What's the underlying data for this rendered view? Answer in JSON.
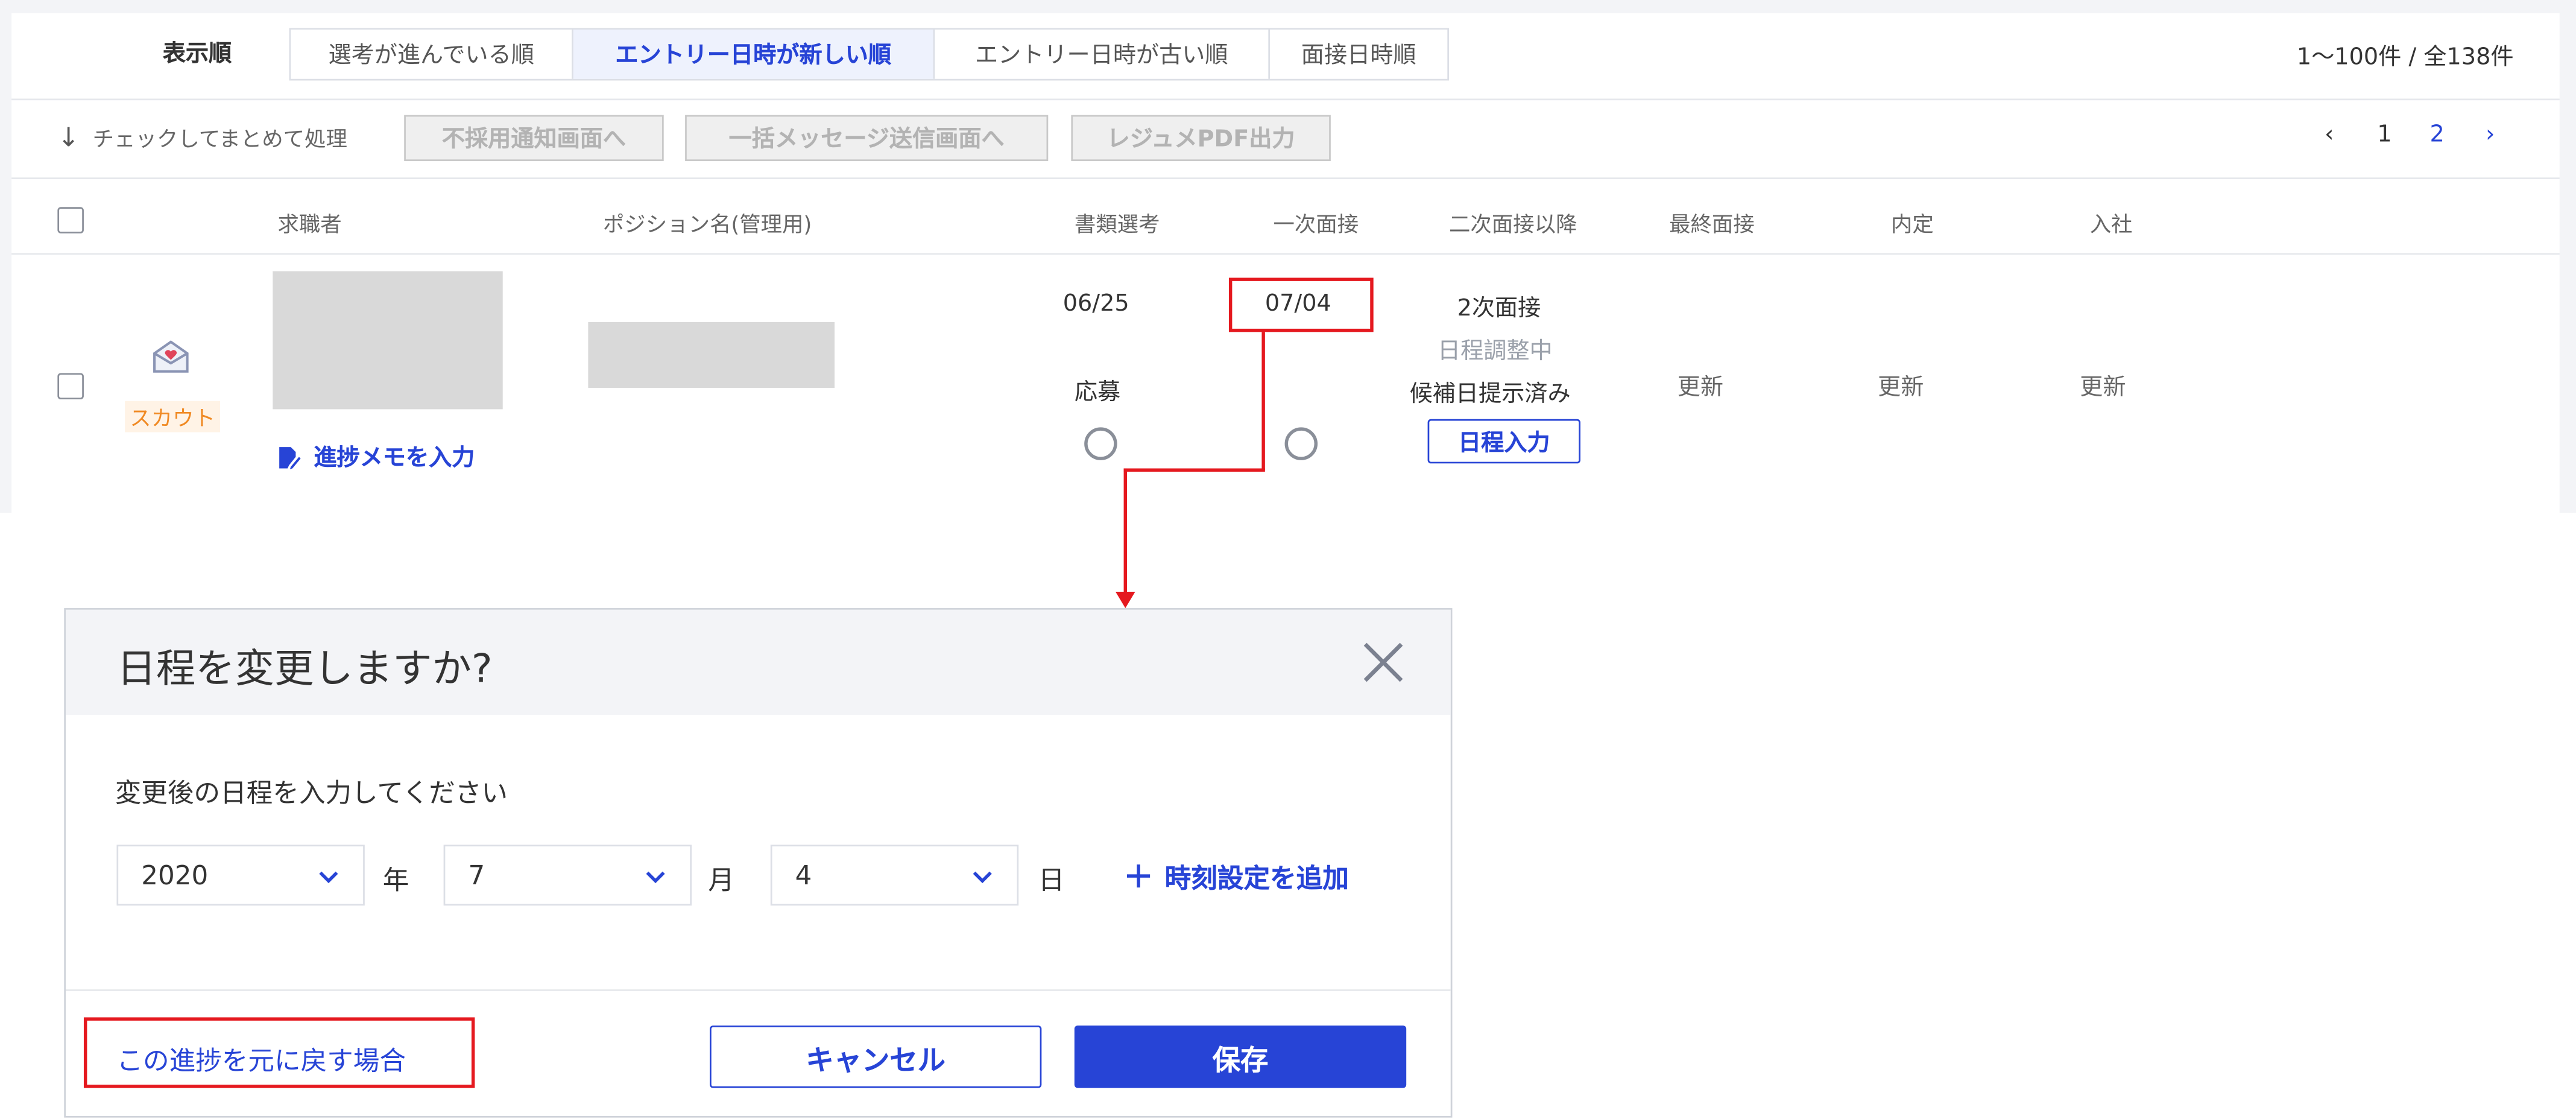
{
  "sort": {
    "label": "表示順",
    "tabs": [
      {
        "label": "選考が進んでいる順",
        "active": false
      },
      {
        "label": "エントリー日時が新しい順",
        "active": true
      },
      {
        "label": "エントリー日時が古い順",
        "active": false
      },
      {
        "label": "面接日時順",
        "active": false
      }
    ]
  },
  "result_count": "1〜100件 / 全138件",
  "bulk": {
    "hint": "チェックしてまとめて処理",
    "buttons": [
      "不採用通知画面へ",
      "一括メッセージ送信画面へ",
      "レジュメPDF出力"
    ]
  },
  "pagination": {
    "prev": "‹",
    "pages": [
      "1",
      "2"
    ],
    "next": "›"
  },
  "columns": [
    "求職者",
    "ポジション名(管理用)",
    "書類選考",
    "一次面接",
    "二次面接以降",
    "最終面接",
    "内定",
    "入社"
  ],
  "row": {
    "badge": "スカウト",
    "memo_link": "進捗メモを入力",
    "doc_date": "06/25",
    "doc_status": "応募",
    "first_interview_date": "07/04",
    "second": {
      "title": "2次面接",
      "status": "日程調整中",
      "substatus": "候補日提示済み",
      "button": "日程入力"
    },
    "final_update": "更新",
    "offer_update": "更新",
    "join_update": "更新"
  },
  "modal": {
    "title": "日程を変更しますか?",
    "instruction": "変更後の日程を入力してください",
    "year": "2020",
    "year_unit": "年",
    "month": "7",
    "month_unit": "月",
    "day": "4",
    "day_unit": "日",
    "add_time": "時刻設定を追加",
    "revert_link": "この進捗を元に戻す場合",
    "cancel": "キャンセル",
    "save": "保存"
  },
  "colors": {
    "accent": "#2744d6",
    "highlight": "#e5191f",
    "badge": "#f08a24"
  }
}
